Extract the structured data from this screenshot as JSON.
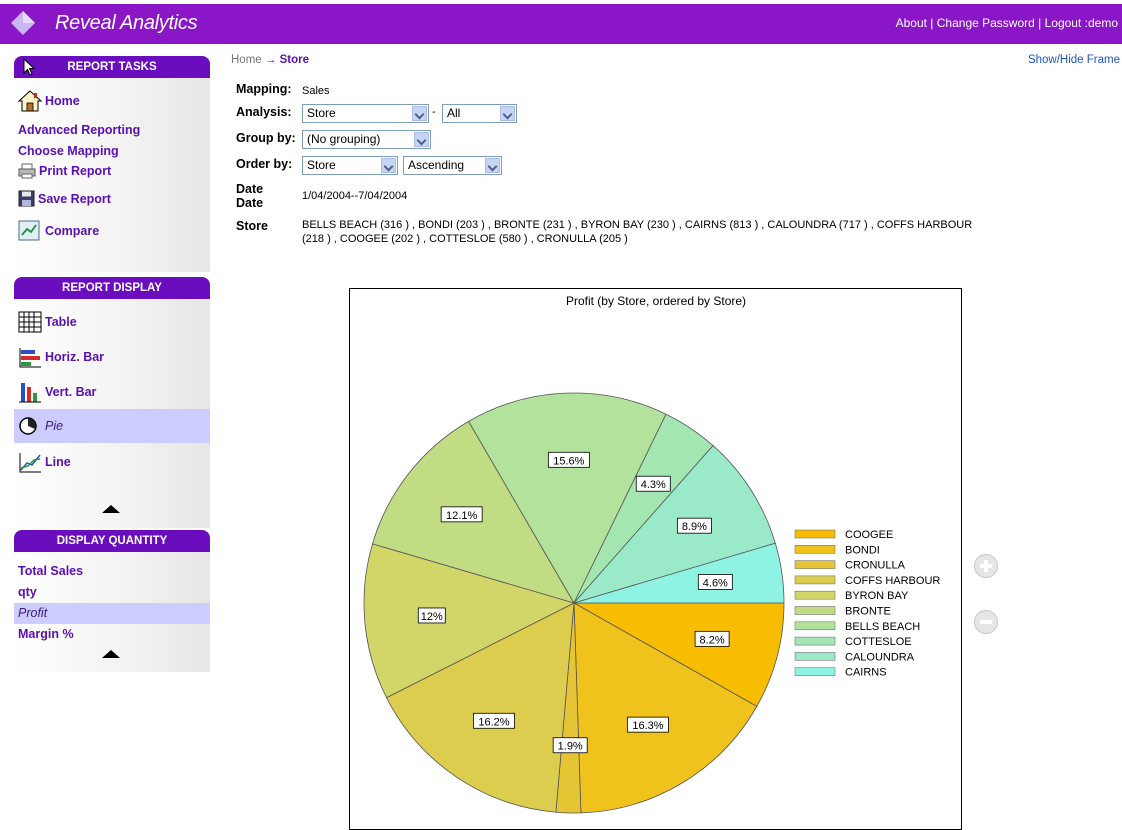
{
  "app": {
    "title": "Reveal Analytics"
  },
  "toplinks": {
    "about": "About",
    "change_password": "Change Password",
    "logout": "Logout :demo",
    "sep": " | "
  },
  "breadcrumb": {
    "home": "Home",
    "arrow": "→",
    "current": "Store"
  },
  "show_hide": "Show/Hide Frame",
  "report_tasks": {
    "title": "REPORT TASKS",
    "items": [
      "Home",
      "Advanced Reporting",
      "Choose Mapping",
      "Print Report",
      "Save Report",
      "Compare"
    ]
  },
  "report_display": {
    "title": "REPORT DISPLAY",
    "items": [
      "Table",
      "Horiz. Bar",
      "Vert. Bar",
      "Pie",
      "Line"
    ],
    "selected": "Pie"
  },
  "display_quantity": {
    "title": "DISPLAY QUANTITY",
    "items": [
      "Total Sales",
      "qty",
      "Profit",
      "Margin %"
    ],
    "selected": "Profit"
  },
  "criteria": {
    "mapping_label": "Mapping:",
    "mapping_value": "Sales",
    "analysis_label": "Analysis:",
    "analysis_value": "Store",
    "analysis_dash": "-",
    "analysis_filter": "All",
    "groupby_label": "Group by:",
    "groupby_value": "(No grouping)",
    "orderby_label": "Order by:",
    "orderby_value": "Store",
    "orderby_direction": "Ascending",
    "date_label": "Date Date",
    "date_value": "1/04/2004--7/04/2004",
    "store_label": "Store",
    "store_line1": "BELLS BEACH (316 ) , BONDI (203 ) , BRONTE (231 ) , BYRON BAY (230 ) , CAIRNS (813 ) , CALOUNDRA (717 ) , COFFS HARBOUR",
    "store_line2": "(218 ) , COOGEE (202 ) , COTTESLOE (580 ) , CRONULLA (205 )"
  },
  "colors": {
    "brand": "#8a16c8",
    "panel_header": "#6a0dbf",
    "link": "#5a0fb0",
    "selected_row": "#ccccff"
  },
  "chart_data": {
    "type": "pie",
    "title": "Profit (by Store, ordered by Store)",
    "slices": [
      {
        "label": "COOGEE",
        "value": 8.2,
        "display": "8.2%",
        "color": "#f8bc00"
      },
      {
        "label": "BONDI",
        "value": 16.3,
        "display": "16.3%",
        "color": "#efc21c"
      },
      {
        "label": "CRONULLA",
        "value": 1.9,
        "display": "1.9%",
        "color": "#e6c534"
      },
      {
        "label": "COFFS HARBOUR",
        "value": 16.2,
        "display": "16.2%",
        "color": "#dccd4e"
      },
      {
        "label": "BYRON BAY",
        "value": 12.0,
        "display": "12%",
        "color": "#d2d567"
      },
      {
        "label": "BRONTE",
        "value": 12.1,
        "display": "12.1%",
        "color": "#c2dc84"
      },
      {
        "label": "BELLS BEACH",
        "value": 15.6,
        "display": "15.6%",
        "color": "#b2e29c"
      },
      {
        "label": "COTTESLOE",
        "value": 4.3,
        "display": "4.3%",
        "color": "#a4e6b2"
      },
      {
        "label": "CALOUNDRA",
        "value": 8.9,
        "display": "8.9%",
        "color": "#9ae9c8"
      },
      {
        "label": "CAIRNS",
        "value": 4.6,
        "display": "4.6%",
        "color": "#8ff3e3"
      }
    ],
    "legend_position": "right",
    "start_angle_deg": 0,
    "direction": "clockwise"
  }
}
